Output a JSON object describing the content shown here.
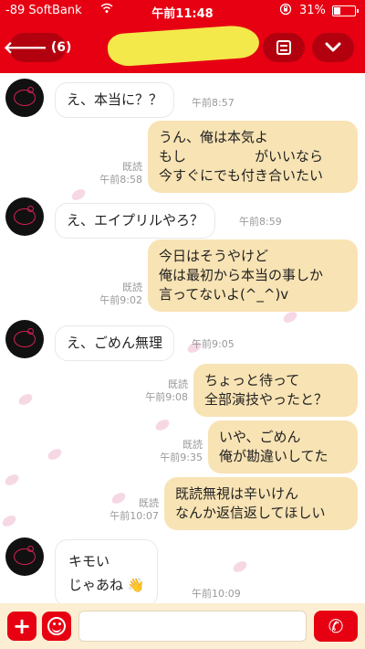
{
  "status_bar": {
    "carrier": "-89 SoftBank",
    "time": "午前11:48",
    "battery_percent": "31%",
    "battery_level": 0.31,
    "icons": [
      "wifi-icon",
      "rotation-lock-icon",
      "battery-icon"
    ]
  },
  "header": {
    "back_label": "(6)",
    "back_arrow": "🡐",
    "dropdown_glyph": "⌄",
    "icons": [
      "back-arrow-icon",
      "menu-icon",
      "chevron-down-icon"
    ]
  },
  "messages": [
    {
      "id": 1,
      "dir": "in",
      "lines": [
        "え、本当に？？"
      ],
      "time": "午前8:57"
    },
    {
      "id": 2,
      "dir": "out",
      "lines": [
        "うん、俺は本気よ",
        "もし　　　　　がいいなら",
        "今すぐにでも付き合いたい"
      ],
      "read": "既読",
      "time": "午前8:58"
    },
    {
      "id": 3,
      "dir": "in",
      "lines": [
        "え、エイプリルやろ？"
      ],
      "time": "午前8:59"
    },
    {
      "id": 4,
      "dir": "out",
      "lines": [
        "今日はそうやけど",
        "俺は最初から本当の事しか",
        "言ってないよ(^_^)v"
      ],
      "read": "既読",
      "time": "午前9:02"
    },
    {
      "id": 5,
      "dir": "in",
      "lines": [
        "え、ごめん無理"
      ],
      "time": "午前9:05"
    },
    {
      "id": 6,
      "dir": "out",
      "lines": [
        "ちょっと待って",
        "全部演技やったと？"
      ],
      "read": "既読",
      "time": "午前9:08"
    },
    {
      "id": 7,
      "dir": "out",
      "lines": [
        "いや、ごめん",
        "俺が勘違いしてた"
      ],
      "read": "既読",
      "time": "午前9:35"
    },
    {
      "id": 8,
      "dir": "out",
      "lines": [
        "既読無視は辛いけん",
        "なんか返信返してほしい"
      ],
      "read": "既読",
      "time": "午前10:07"
    },
    {
      "id": 9,
      "dir": "in",
      "lines": [
        "キモい",
        "じゃあね 👋"
      ],
      "time": "午前10:09"
    }
  ],
  "input_bar": {
    "plus_label": "+",
    "call_icon": "✆",
    "icons": [
      "plus-icon",
      "emoji-icon",
      "phone-icon"
    ]
  },
  "colors": {
    "brand_red": "#e60012",
    "outgoing_bubble": "#f8e3b4",
    "incoming_bubble": "#ffffff",
    "input_bar_bg": "#fbeed2",
    "name_redaction": "#f3e94a"
  }
}
